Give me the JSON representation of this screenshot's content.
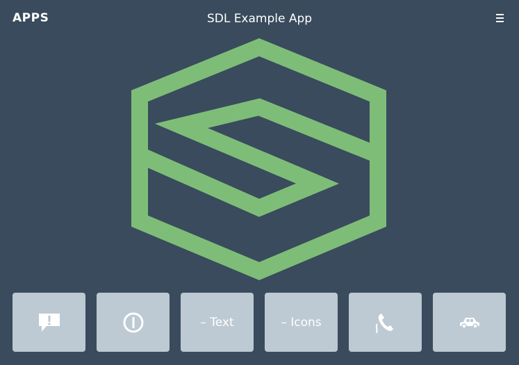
{
  "header": {
    "apps_label": "APPS",
    "title": "SDL Example App",
    "menu_icon": "hamburger-menu-icon"
  },
  "logo": {
    "icon": "sdl-logo-icon",
    "color": "#7ebd78"
  },
  "soft_buttons": [
    {
      "icon": "alert-icon",
      "label": ""
    },
    {
      "icon": "power-icon",
      "label": ""
    },
    {
      "icon": "",
      "label": "– Text"
    },
    {
      "icon": "",
      "label": "– Icons"
    },
    {
      "icon": "phone-icon",
      "label": ""
    },
    {
      "icon": "car-icon",
      "label": ""
    }
  ],
  "colors": {
    "background": "#394b5c",
    "button_background": "#bdc9d3",
    "text": "#ffffff",
    "logo": "#7ebd78"
  }
}
